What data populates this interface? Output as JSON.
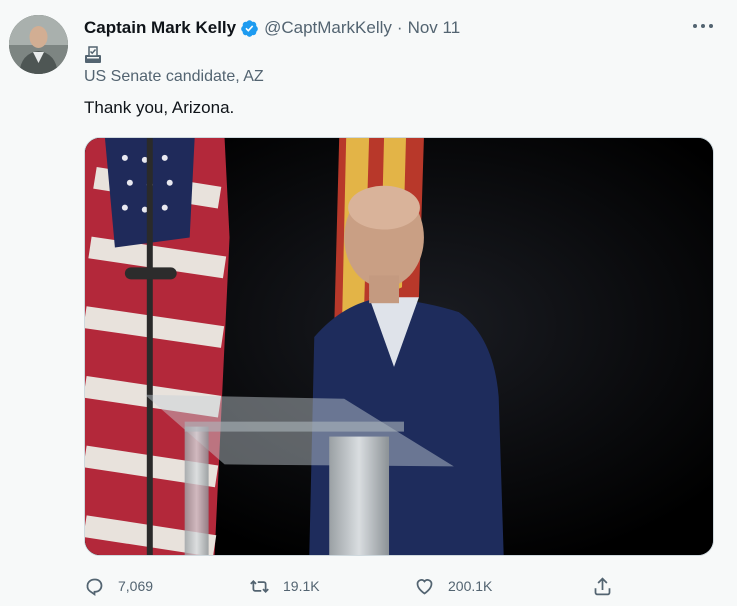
{
  "tweet": {
    "display_name": "Captain Mark Kelly",
    "handle": "@CaptMarkKelly",
    "separator": "·",
    "date": "Nov 11",
    "label": "US Senate candidate, AZ",
    "text": "Thank you, Arizona.",
    "verified_color": "#1d9bf0",
    "icons": {
      "verified": "verified-badge-icon",
      "label": "ballot-box-icon",
      "more": "more-options-icon",
      "reply": "reply-icon",
      "retweet": "retweet-icon",
      "like": "like-heart-icon",
      "share": "share-icon"
    }
  },
  "stats": {
    "replies": "7,069",
    "retweets": "19.1K",
    "likes": "200.1K"
  },
  "colors": {
    "background": "#f7f9f9",
    "text_primary": "#0f1419",
    "text_secondary": "#536471"
  }
}
